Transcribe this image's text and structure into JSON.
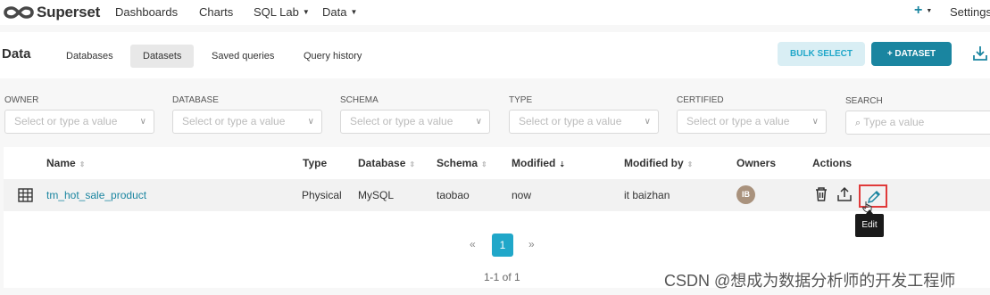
{
  "nav": {
    "brand": "Superset",
    "items": [
      "Dashboards",
      "Charts",
      "SQL Lab",
      "Data"
    ],
    "plus": "+",
    "settings": "Settings"
  },
  "subheader": {
    "title": "Data",
    "tabs": [
      "Databases",
      "Datasets",
      "Saved queries",
      "Query history"
    ],
    "active_tab": "Datasets",
    "bulk_select": "BULK SELECT",
    "add_dataset": "+ DATASET"
  },
  "filters": [
    {
      "label": "OWNER",
      "placeholder": "Select or type a value"
    },
    {
      "label": "DATABASE",
      "placeholder": "Select or type a value"
    },
    {
      "label": "SCHEMA",
      "placeholder": "Select or type a value"
    },
    {
      "label": "TYPE",
      "placeholder": "Select or type a value"
    },
    {
      "label": "CERTIFIED",
      "placeholder": "Select or type a value"
    }
  ],
  "search": {
    "label": "SEARCH",
    "placeholder": "Type a value"
  },
  "table": {
    "columns": [
      "Name",
      "Type",
      "Database",
      "Schema",
      "Modified",
      "Modified by",
      "Owners",
      "Actions"
    ],
    "rows": [
      {
        "name": "tm_hot_sale_product",
        "type": "Physical",
        "database": "MySQL",
        "schema": "taobao",
        "modified": "now",
        "modified_by": "it baizhan",
        "owner_initials": "IB"
      }
    ]
  },
  "tooltip": "Edit",
  "pagination": {
    "prev": "«",
    "page": "1",
    "next": "»",
    "info": "1-1 of 1"
  },
  "watermark": "CSDN @想成为数据分析师的开发工程师",
  "colors": {
    "primary": "#1a85a0",
    "accent": "#20a7c9",
    "highlight": "#e03a3a"
  }
}
